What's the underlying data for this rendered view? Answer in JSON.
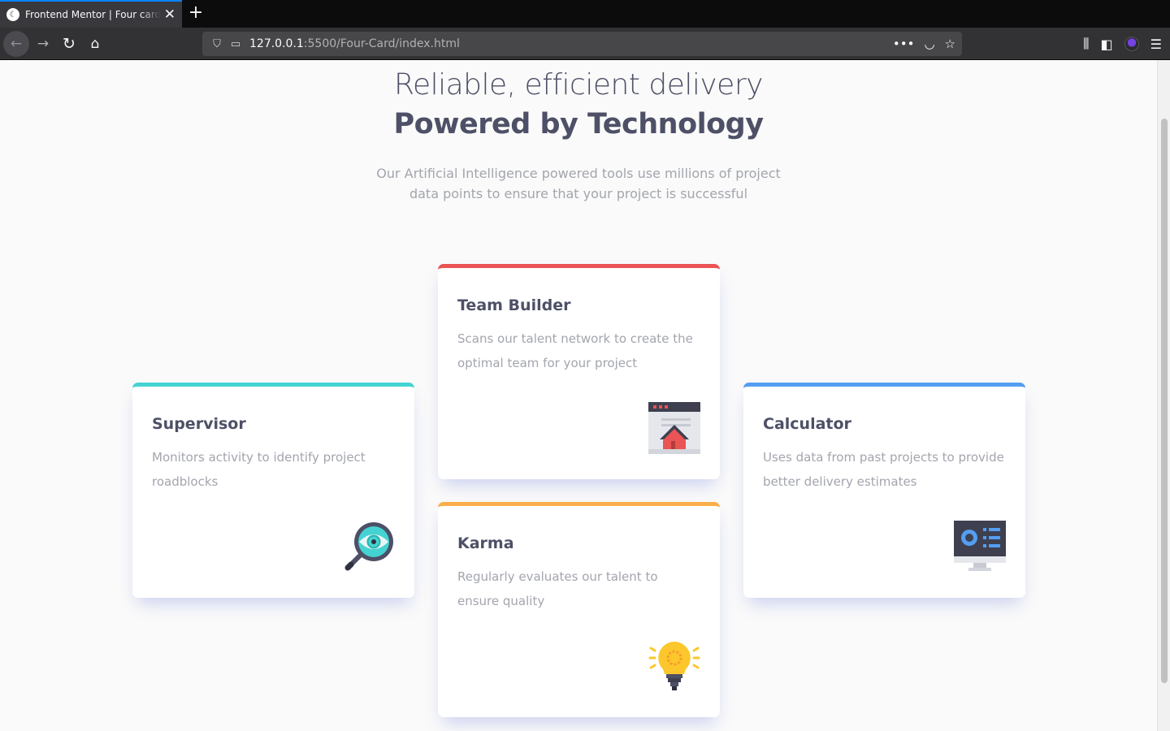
{
  "browser": {
    "tab_title": "Frontend Mentor | Four card feature section",
    "new_tab_label": "+",
    "tab_close_label": "✕",
    "favicon_label": "☾",
    "url_host": "127.0.0.1",
    "url_rest": ":5500/Four-Card/index.html",
    "nav": {
      "back": "←",
      "forward": "→",
      "reload": "↻",
      "home": "⌂"
    },
    "url_icons": {
      "shield": "⛉",
      "page": "▭"
    },
    "url_actions": {
      "more": "•••",
      "pocket": "◡",
      "bookmark": "☆"
    },
    "toolbar": {
      "library": "⫼",
      "sidebar": "◧",
      "menu": "☰"
    }
  },
  "page": {
    "heading_light": "Reliable, efficient delivery",
    "heading_bold": "Powered by Technology",
    "intro": "Our Artificial Intelligence powered tools use millions of project data points to ensure that your project is successful"
  },
  "cards": {
    "supervisor": {
      "title": "Supervisor",
      "description": "Monitors activity to identify project roadblocks",
      "icon": "magnifier-eye-icon",
      "accent": "#44d3d2"
    },
    "team_builder": {
      "title": "Team Builder",
      "description": "Scans our talent network to create the optimal team for your project",
      "icon": "house-window-icon",
      "accent": "#ea5454"
    },
    "karma": {
      "title": "Karma",
      "description": "Regularly evaluates our talent to ensure quality",
      "icon": "lightbulb-icon",
      "accent": "#fcae4a"
    },
    "calculator": {
      "title": "Calculator",
      "description": "Uses data from past projects to provide better delivery estimates",
      "icon": "monitor-chart-icon",
      "accent": "#549ef2"
    }
  }
}
